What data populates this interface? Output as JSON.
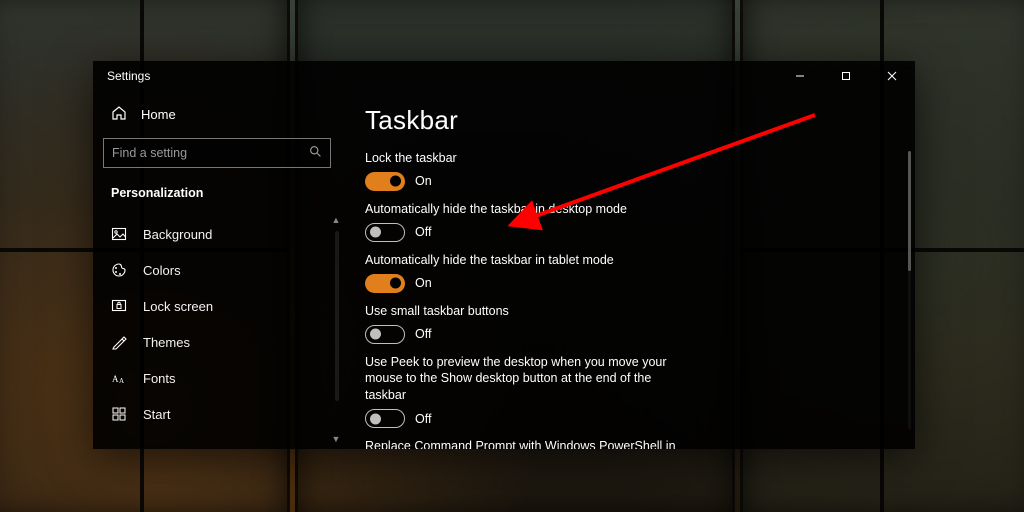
{
  "accent_color": "#e07f1b",
  "arrow_color": "#ff0000",
  "window": {
    "title": "Settings",
    "sidebar": {
      "home_label": "Home",
      "search_placeholder": "Find a setting",
      "category": "Personalization",
      "items": [
        {
          "icon": "image",
          "label": "Background"
        },
        {
          "icon": "palette",
          "label": "Colors"
        },
        {
          "icon": "lock",
          "label": "Lock screen"
        },
        {
          "icon": "theme",
          "label": "Themes"
        },
        {
          "icon": "font",
          "label": "Fonts"
        },
        {
          "icon": "start",
          "label": "Start"
        }
      ]
    },
    "page": {
      "heading": "Taskbar",
      "settings": [
        {
          "label": "Lock the taskbar",
          "state": true,
          "state_text": "On"
        },
        {
          "label": "Automatically hide the taskbar in desktop mode",
          "state": false,
          "state_text": "Off"
        },
        {
          "label": "Automatically hide the taskbar in tablet mode",
          "state": true,
          "state_text": "On"
        },
        {
          "label": "Use small taskbar buttons",
          "state": false,
          "state_text": "Off"
        },
        {
          "label": "Use Peek to preview the desktop when you move your mouse to the Show desktop button at the end of the taskbar",
          "state": false,
          "state_text": "Off"
        },
        {
          "label": "Replace Command Prompt with Windows PowerShell in the menu when I right-click the start button or press Windows key+X"
        }
      ]
    }
  }
}
